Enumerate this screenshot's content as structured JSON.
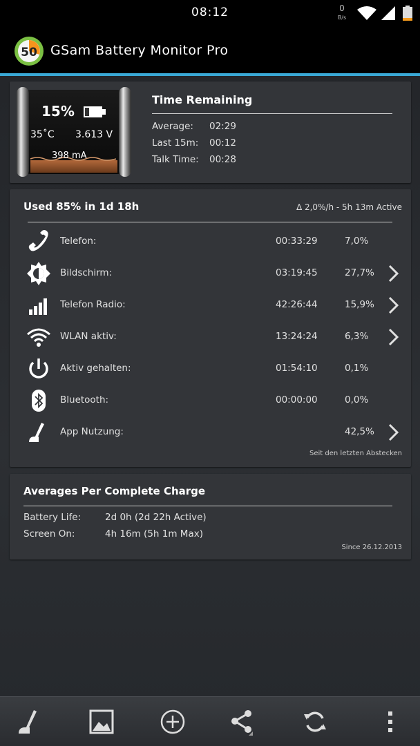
{
  "status_bar": {
    "time": "08:12",
    "net_value": "0",
    "net_unit": "B/s"
  },
  "app": {
    "title": "GSam Battery Monitor Pro",
    "logo_text": "50"
  },
  "battery": {
    "percent": "15%",
    "level": 0.15,
    "temperature": "35˚C",
    "voltage": "3.613 V",
    "current": "398 mA"
  },
  "time_remaining": {
    "title": "Time Remaining",
    "rows": [
      {
        "label": "Average:",
        "value": "02:29"
      },
      {
        "label": "Last 15m:",
        "value": "00:12"
      },
      {
        "label": "Talk Time:",
        "value": "00:28"
      }
    ]
  },
  "usage": {
    "title": "Used 85% in 1d 18h",
    "rate": "∆ 2,0%/h - 5h 13m Active",
    "rows": [
      {
        "icon": "phone-icon",
        "label": "Telefon:",
        "duration": "00:33:29",
        "percent": "7,0%"
      },
      {
        "icon": "brightness-icon",
        "label": "Bildschirm:",
        "duration": "03:19:45",
        "percent": "27,7%"
      },
      {
        "icon": "signal-bars-icon",
        "label": "Telefon Radio:",
        "duration": "42:26:44",
        "percent": "15,9%"
      },
      {
        "icon": "wifi-icon",
        "label": "WLAN aktiv:",
        "duration": "13:24:24",
        "percent": "6,3%"
      },
      {
        "icon": "power-icon",
        "label": "Aktiv gehalten:",
        "duration": "01:54:10",
        "percent": "0,1%"
      },
      {
        "icon": "bluetooth-icon",
        "label": "Bluetooth:",
        "duration": "00:00:00",
        "percent": "0,0%"
      },
      {
        "icon": "app-usage-icon",
        "label": "App Nutzung:",
        "duration": "",
        "percent": "42,5%"
      }
    ],
    "footer": "Seit den letzten Abstecken"
  },
  "averages": {
    "title": "Averages Per Complete Charge",
    "rows": [
      {
        "label": "Battery Life:",
        "value": "2d 0h (2d 22h Active)"
      },
      {
        "label": "Screen On:",
        "value": "4h 16m (5h 1m Max)"
      }
    ],
    "footer": "Since 26.12.2013"
  },
  "bottom_bar": [
    "app-usage-icon",
    "image-icon",
    "add-icon",
    "share-icon",
    "refresh-icon",
    "overflow-menu-icon"
  ],
  "colors": {
    "accent": "#3aa9d6",
    "battery_fill": "#8a4a22",
    "card": "#333539"
  }
}
